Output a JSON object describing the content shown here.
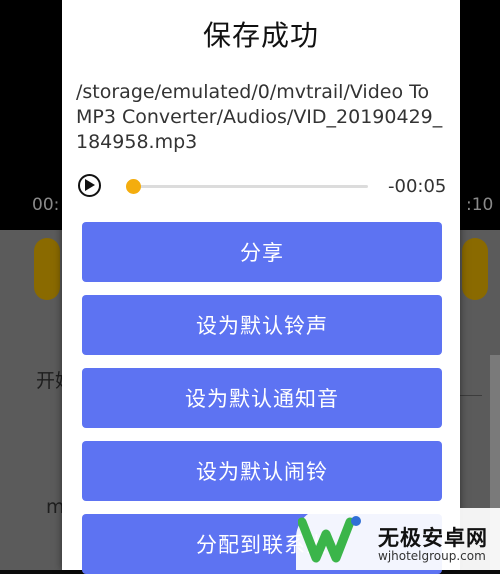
{
  "background": {
    "time_left": "00:",
    "time_right": ":10",
    "label_start": "开始",
    "label_m": "m"
  },
  "dialog": {
    "title": "保存成功",
    "path": "/storage/emulated/0/mvtrail/Video To MP3 Converter/Audios/VID_20190429_184958.mp3",
    "player": {
      "duration": "-00:05",
      "progress": 0.0,
      "accent": "#f4ad0e"
    },
    "buttons": [
      {
        "label": "分享"
      },
      {
        "label": "设为默认铃声"
      },
      {
        "label": "设为默认通知音"
      },
      {
        "label": "设为默认闹铃"
      },
      {
        "label": "分配到联系人"
      }
    ],
    "button_color": "#5d73f2"
  },
  "watermark": {
    "title": "无极安卓网",
    "url": "wjhotelgroup.com",
    "logo_green": "#3bb54a"
  }
}
